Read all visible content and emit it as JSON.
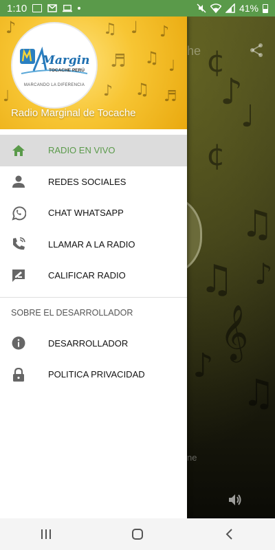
{
  "status_bar": {
    "time": "1:10",
    "battery_text": "41%",
    "icons": [
      "image-icon",
      "mail-icon",
      "laptop-icon",
      "dot-icon",
      "mute-icon",
      "wifi-icon",
      "signal-icon",
      "battery-icon"
    ]
  },
  "background_app": {
    "title_fragment": "he",
    "subtitle_fragment": "ne",
    "icons": [
      "share-icon",
      "volume-icon"
    ]
  },
  "drawer": {
    "header": {
      "logo_text": "Marginal",
      "logo_sub": "TOCACHE PERÚ",
      "logo_tagline": "MARCANDO LA DIFERENCIA",
      "title": "Radio Marginal de Tocache"
    },
    "items": [
      {
        "label": "RADIO EN VIVO",
        "icon": "home-icon",
        "active": true
      },
      {
        "label": "REDES SOCIALES",
        "icon": "person-icon",
        "active": false
      },
      {
        "label": "CHAT WHATSAPP",
        "icon": "whatsapp-icon",
        "active": false
      },
      {
        "label": "LLAMAR A LA RADIO",
        "icon": "phone-ring-icon",
        "active": false
      },
      {
        "label": "CALIFICAR RADIO",
        "icon": "rate-review-icon",
        "active": false
      }
    ],
    "section_title": "SOBRE EL DESARROLLADOR",
    "section_items": [
      {
        "label": "DESARROLLADOR",
        "icon": "info-icon"
      },
      {
        "label": "POLITICA PRIVACIDAD",
        "icon": "lock-icon"
      }
    ]
  },
  "nav_bar": {
    "buttons": [
      "recents-icon",
      "home-circle-icon",
      "back-icon"
    ]
  },
  "colors": {
    "accent": "#5a9a4a",
    "header_yellow": "#f7c533",
    "active_row": "#dcdcdc"
  }
}
